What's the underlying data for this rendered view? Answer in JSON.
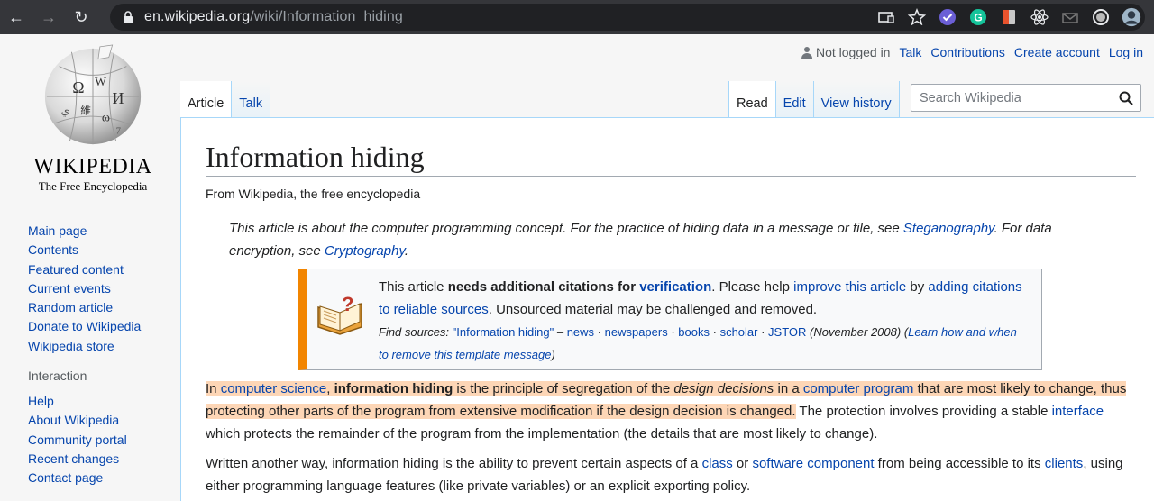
{
  "browser": {
    "back": "←",
    "forward": "→",
    "reload": "↻",
    "url_host": "en.wikipedia.org",
    "url_path": "/wiki/Information_hiding"
  },
  "logo": {
    "wordmark": "WIKIPEDIA",
    "tagline": "The Free Encyclopedia"
  },
  "sidebar": {
    "nav": [
      "Main page",
      "Contents",
      "Featured content",
      "Current events",
      "Random article",
      "Donate to Wikipedia",
      "Wikipedia store"
    ],
    "interaction_heading": "Interaction",
    "interaction": [
      "Help",
      "About Wikipedia",
      "Community portal",
      "Recent changes",
      "Contact page"
    ]
  },
  "personal": {
    "not_logged_in": "Not logged in",
    "talk": "Talk",
    "contributions": "Contributions",
    "create_account": "Create account",
    "log_in": "Log in"
  },
  "tabs": {
    "article": "Article",
    "talk": "Talk",
    "read": "Read",
    "edit": "Edit",
    "view_history": "View history"
  },
  "search": {
    "placeholder": "Search Wikipedia"
  },
  "article": {
    "title": "Information hiding",
    "site_sub": "From Wikipedia, the free encyclopedia",
    "hatnote": {
      "t1": "This article is about the computer programming concept. For the practice of hiding data in a message or file, see ",
      "l1": "Steganography",
      "t2": ". For data encryption, see ",
      "l2": "Cryptography",
      "t3": "."
    },
    "ambox": {
      "t1": "This article ",
      "b1": "needs additional citations for ",
      "l1": "verification",
      "t2": ". Please help ",
      "l2": "improve this article",
      "t3": " by ",
      "l3": "adding citations to reliable sources",
      "t4": ". Unsourced material may be challenged and removed.",
      "find": "Find sources: ",
      "q": "\"Information hiding\"",
      "dash": " – ",
      "news": "news",
      "sep": " · ",
      "newspapers": "newspapers",
      "books": "books",
      "scholar": "scholar",
      "jstor": "JSTOR",
      "date": " (November 2008) (",
      "learn": "Learn how and when to remove this template message",
      "close": ")"
    },
    "p1": {
      "t1": "In ",
      "l1": "computer science",
      "t2": ", ",
      "b1": "information hiding",
      "t3": " is the principle of segregation of the ",
      "i1": "design decisions",
      "t4": " in a ",
      "l2": "computer program",
      "t5": " that are most likely to change, thus protecting other parts of the program from extensive modification if the design decision is changed.",
      "t6": " The protection involves providing a stable ",
      "l3": "interface",
      "t7": " which protects the remainder of the program from the implementation (the details that are most likely to change)."
    },
    "p2": {
      "t1": "Written another way, information hiding is the ability to prevent certain aspects of a ",
      "l1": "class",
      "t2": " or ",
      "l2": "software component",
      "t3": " from being accessible to its ",
      "l3": "clients",
      "t4": ", using either programming language features (like private variables) or an explicit exporting policy."
    }
  },
  "icons": [
    "back-icon",
    "forward-icon",
    "reload-icon",
    "lock-icon",
    "cast-icon",
    "star-icon",
    "user-icon",
    "search-icon",
    "book-question-icon"
  ],
  "colors": {
    "link": "#0645ad",
    "highlight": "#fdd6b6",
    "ambox_border": "#f28500",
    "tab_border": "#a7d7f9"
  }
}
